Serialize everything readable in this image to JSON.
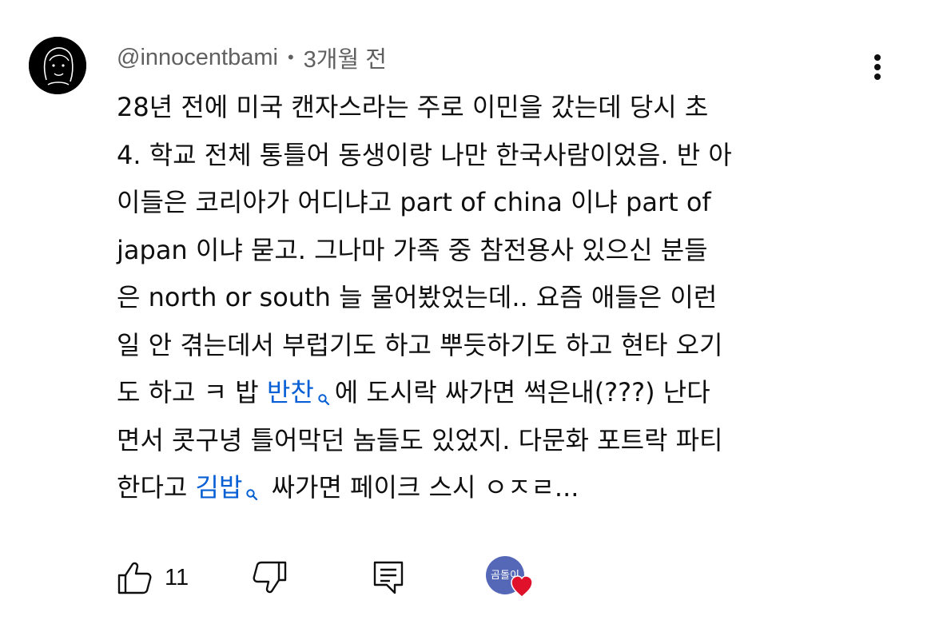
{
  "comment": {
    "author": "@innocentbami",
    "separator": "•",
    "time": "3개월 전",
    "lines": [
      {
        "text": "28년 전에 미국 캔자스라는 주로 이민을 갔는데 당시 초"
      },
      {
        "text": "4. 학교 전체 통틀어 동생이랑 나만 한국사람이었음. 반 아"
      },
      {
        "text": "이들은 코리아가 어디냐고 part of china 이냐 part of"
      },
      {
        "text": "japan 이냐 묻고. 그나마  가족 중 참전용사 있으신 분들"
      },
      {
        "text": "은 north or south 늘 물어봤었는데.. 요즘 애들은 이런"
      },
      {
        "text": "일 안 겪는데서 부럽기도 하고 뿌듯하기도 하고 현타 오기"
      },
      {
        "before": "도 하고 ㅋ 밥 ",
        "link": "반찬",
        "after": "에 도시락 싸가면 썩은내(???) 난다"
      },
      {
        "text": "면서 콧구녕 틀어막던 놈들도 있었지. 다문화 포트락 파티"
      },
      {
        "before": "한다고 ",
        "link": "김밥",
        "after": " 싸가면 페이크 스시 ㅇㅈㄹ..."
      }
    ]
  },
  "actions": {
    "like_count": "11",
    "like_icon": "thumbs-up-icon",
    "dislike_icon": "thumbs-down-icon",
    "reply_icon": "reply-comment-icon",
    "creator_badge_text": "곰돌이",
    "creator_heart_color": "#e0112b"
  },
  "colors": {
    "text": "#0f0f0f",
    "meta": "#606060",
    "link": "#065fd4",
    "creator_avatar_bg": "#5568b8"
  }
}
